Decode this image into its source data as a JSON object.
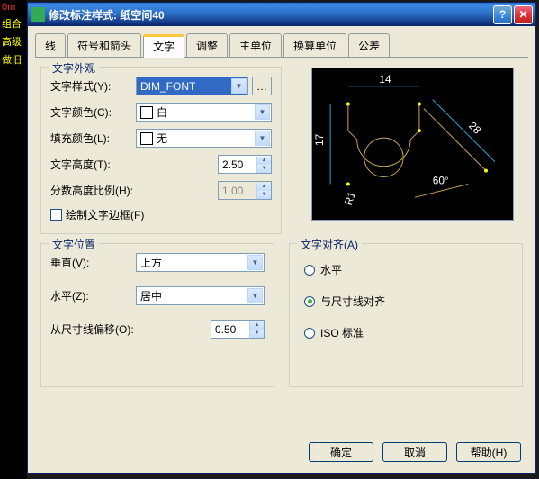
{
  "window": {
    "title": "修改标注样式: 纸空间40"
  },
  "tabs": [
    "线",
    "符号和箭头",
    "文字",
    "调整",
    "主单位",
    "换算单位",
    "公差"
  ],
  "appearance": {
    "legend": "文字外观",
    "style_label": "文字样式(Y):",
    "style_value": "DIM_FONT",
    "color_label": "文字颜色(C):",
    "color_value": "白",
    "fill_label": "填充颜色(L):",
    "fill_value": "无",
    "height_label": "文字高度(T):",
    "height_value": "2.50",
    "fraction_label": "分数高度比例(H):",
    "fraction_value": "1.00",
    "border_label": "绘制文字边框(F)"
  },
  "position": {
    "legend": "文字位置",
    "vert_label": "垂直(V):",
    "vert_value": "上方",
    "horiz_label": "水平(Z):",
    "horiz_value": "居中",
    "offset_label": "从尺寸线偏移(O):",
    "offset_value": "0.50"
  },
  "align": {
    "legend": "文字对齐(A)",
    "opt1": "水平",
    "opt2": "与尺寸线对齐",
    "opt3": "ISO 标准"
  },
  "buttons": {
    "ok": "确定",
    "cancel": "取消",
    "help": "帮助(H)"
  },
  "preview": {
    "dim_top": "14",
    "dim_left": "17",
    "dim_diag": "28",
    "angle": "60°",
    "radius": "R1"
  },
  "bg": [
    "0m",
    "组合",
    "高级",
    "做旧"
  ]
}
